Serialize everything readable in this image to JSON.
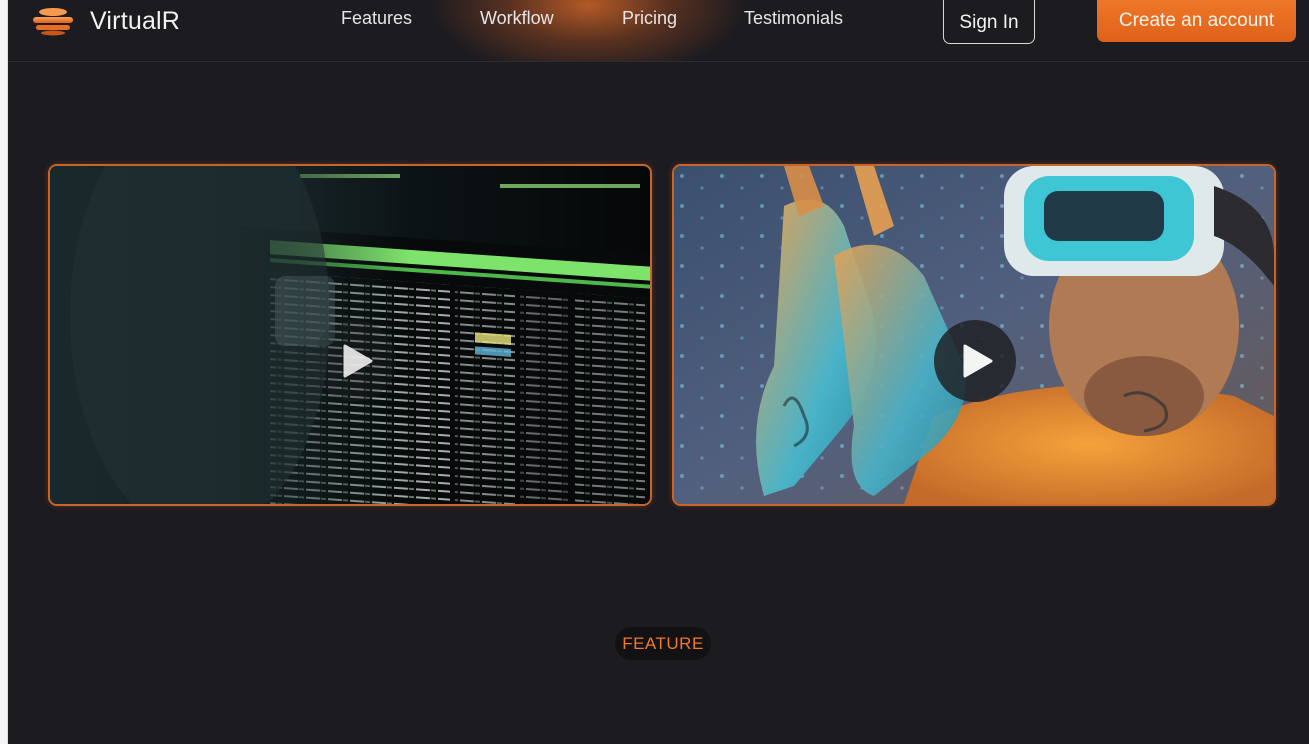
{
  "brand": {
    "name": "VirtualR",
    "logo_icon": "layered-disc-logo-icon"
  },
  "nav": {
    "links": [
      "Features",
      "Workflow",
      "Pricing",
      "Testimonials"
    ],
    "signin_label": "Sign In",
    "create_label": "Create an account"
  },
  "videos": [
    {
      "subject": "terminal-screen-thumbnail",
      "play_icon": "play-icon"
    },
    {
      "subject": "vr-headset-user-thumbnail",
      "play_icon": "play-icon"
    }
  ],
  "section": {
    "badge": "FEATURE"
  },
  "colors": {
    "accent": "#f07a2a",
    "background": "#1c1b20",
    "card_border": "#c9652a",
    "text": "#e6e6e8"
  }
}
